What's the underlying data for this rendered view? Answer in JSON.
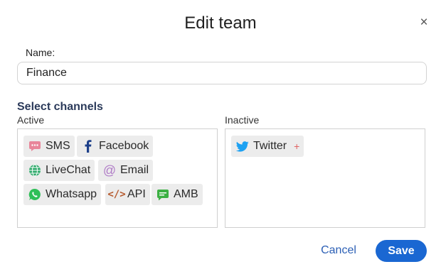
{
  "dialog": {
    "title": "Edit team",
    "close_symbol": "×"
  },
  "name_field": {
    "label": "Name:",
    "value": "Finance"
  },
  "channels": {
    "section_title": "Select channels",
    "active_label": "Active",
    "inactive_label": "Inactive",
    "active": [
      {
        "label": "SMS",
        "icon": "sms-icon",
        "color": "#e8869a"
      },
      {
        "label": "Facebook",
        "icon": "facebook-icon",
        "color": "#1d3f8a"
      },
      {
        "label": "LiveChat",
        "icon": "globe-icon",
        "color": "#2faa6b"
      },
      {
        "label": "Email",
        "icon": "at-icon",
        "color": "#b07cc7"
      },
      {
        "label": "Whatsapp",
        "icon": "whatsapp-icon",
        "color": "#2fbf58"
      },
      {
        "label": "API",
        "icon": "code-icon",
        "color": "#b65a2e"
      },
      {
        "label": "AMB",
        "icon": "message-icon",
        "color": "#3cb043"
      }
    ],
    "inactive": [
      {
        "label": "Twitter",
        "icon": "twitter-icon",
        "color": "#1da1f2",
        "add_symbol": "+"
      }
    ]
  },
  "footer": {
    "cancel_label": "Cancel",
    "save_label": "Save"
  },
  "colors": {
    "primary": "#1a67d2",
    "link": "#2b5fb5",
    "chip_bg": "#ececec"
  }
}
